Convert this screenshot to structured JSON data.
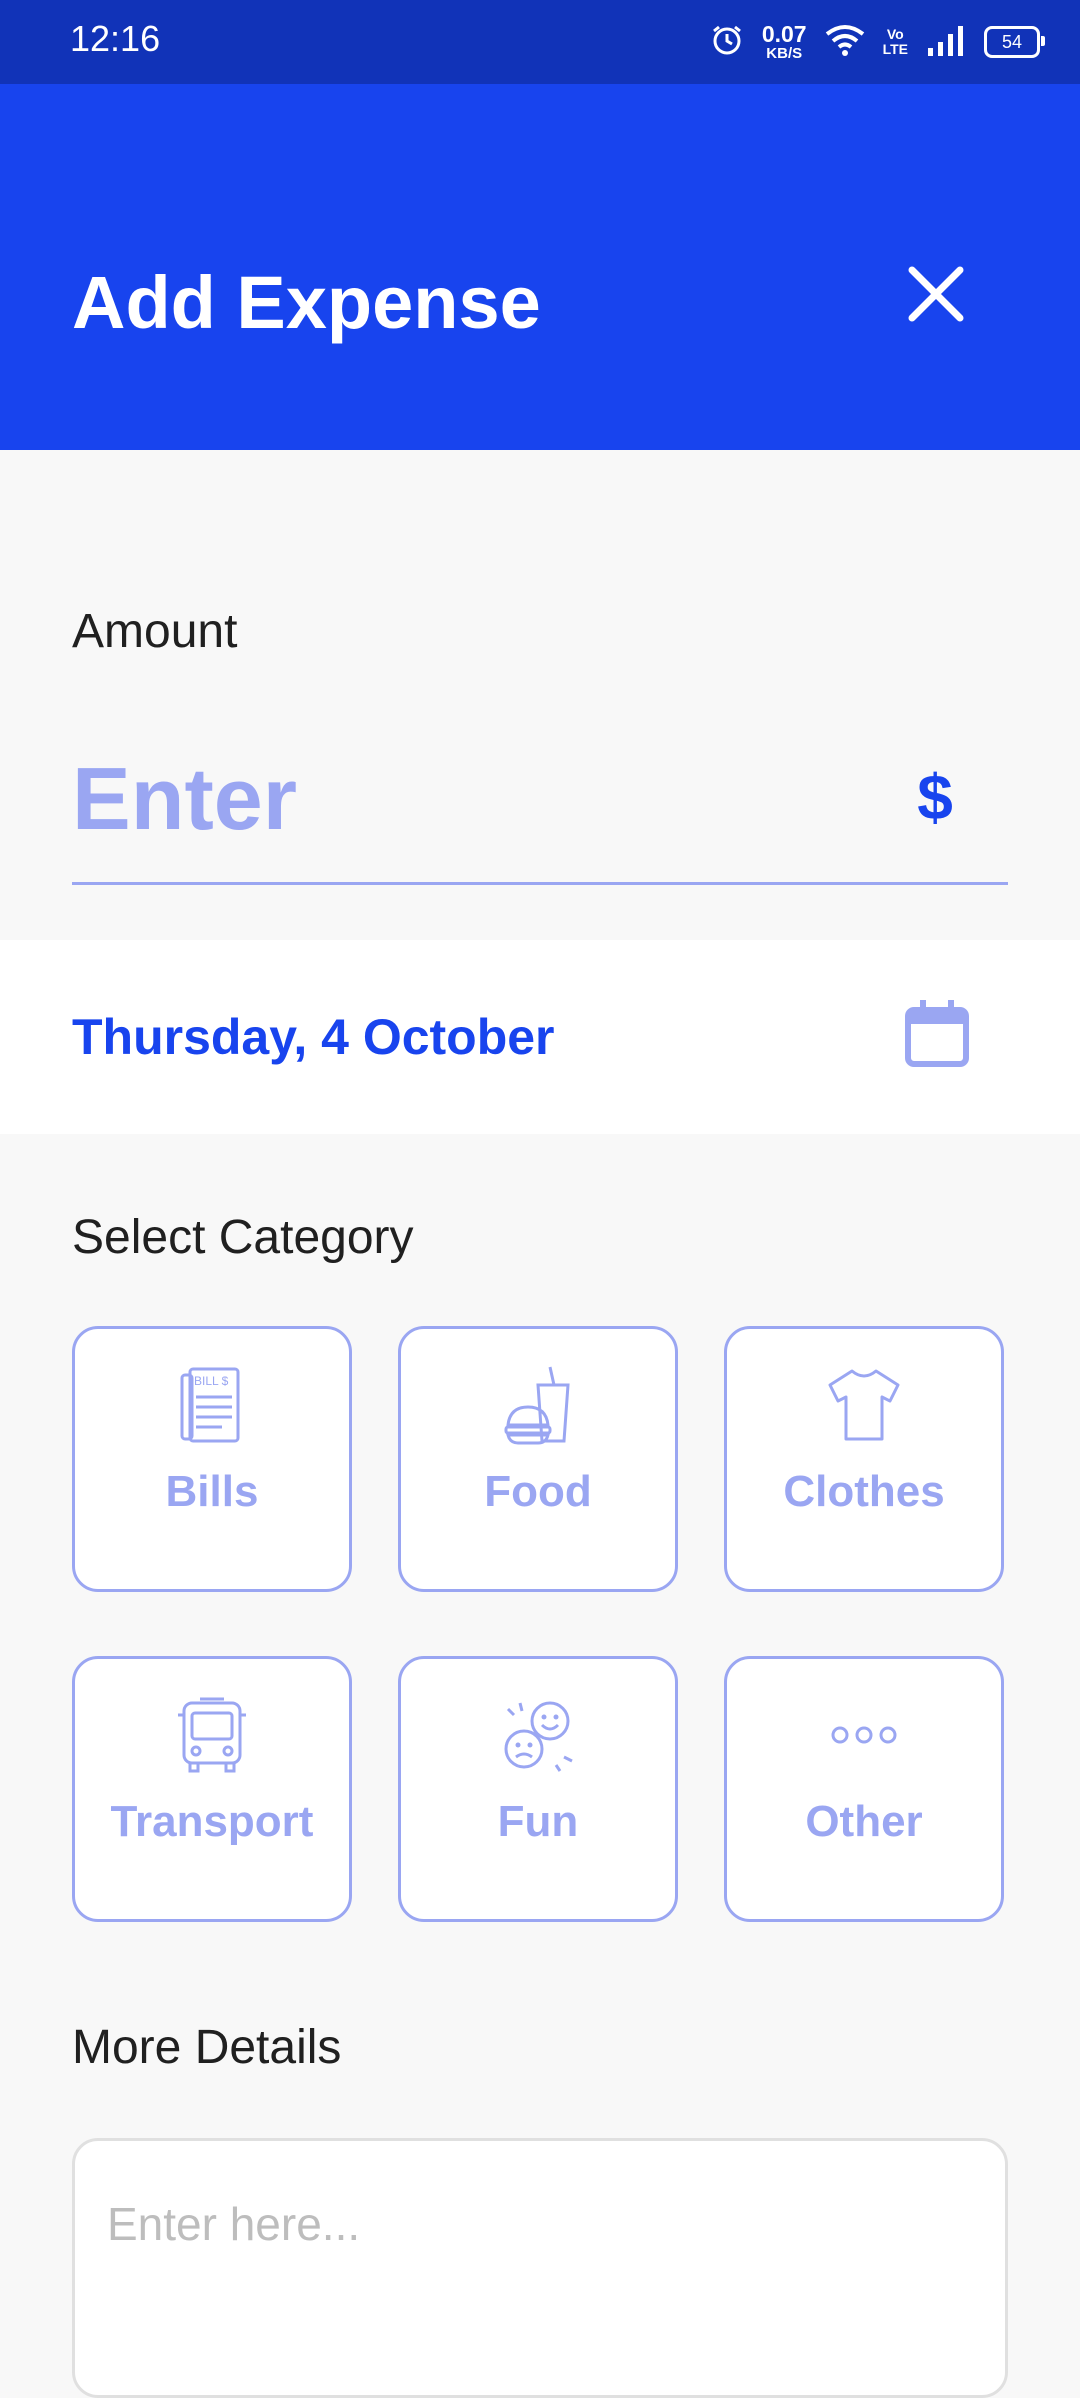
{
  "status_bar": {
    "time": "12:16",
    "net_speed_value": "0.07",
    "net_speed_unit": "KB/S",
    "volte_top": "Vo",
    "volte_bottom": "LTE",
    "battery": "54",
    "icons": [
      "alarm-icon",
      "wifi-icon",
      "volte-icon",
      "signal-icon",
      "battery-icon"
    ]
  },
  "header": {
    "title": "Add Expense",
    "close_icon": "close-icon",
    "background_color": "#1844ee"
  },
  "amount": {
    "label": "Amount",
    "placeholder": "Enter",
    "currency_icon": "dollar-icon",
    "currency_symbol": "$"
  },
  "date": {
    "value": "Thursday, 4 October",
    "icon": "calendar-icon"
  },
  "category": {
    "label": "Select Category",
    "items": [
      {
        "label": "Bills",
        "icon": "bill-icon"
      },
      {
        "label": "Food",
        "icon": "food-icon"
      },
      {
        "label": "Clothes",
        "icon": "tshirt-icon"
      },
      {
        "label": "Transport",
        "icon": "bus-icon"
      },
      {
        "label": "Fun",
        "icon": "fun-masks-icon"
      },
      {
        "label": "Other",
        "icon": "more-dots-icon"
      }
    ]
  },
  "details": {
    "label": "More Details",
    "placeholder": "Enter here..."
  },
  "colors": {
    "accent": "#1844ee",
    "accent_light": "#9aa6f2",
    "status_bar": "#1133b8"
  }
}
